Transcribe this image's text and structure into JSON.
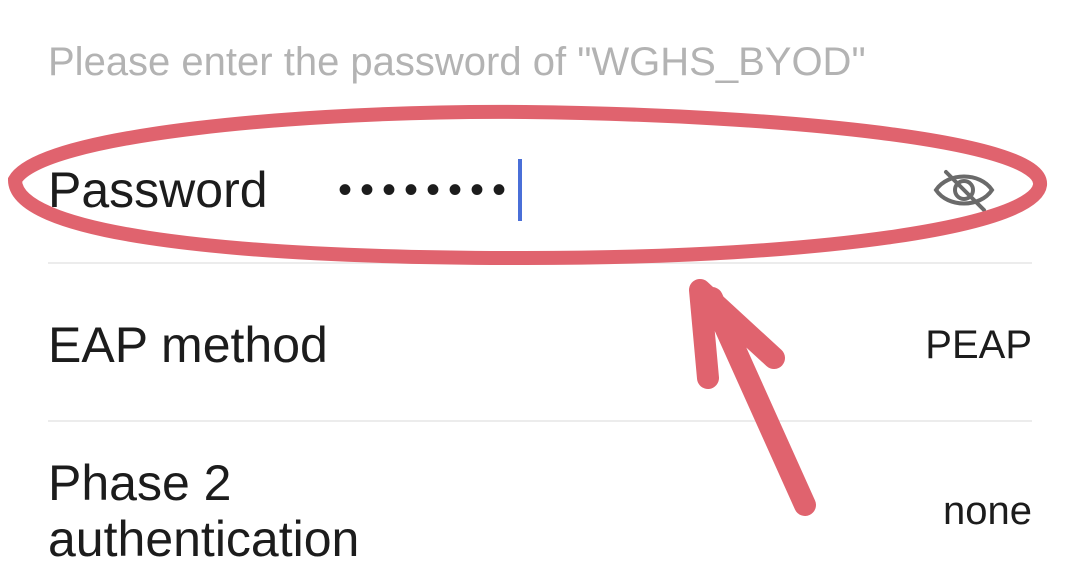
{
  "prompt": "Please enter the password of \"WGHS_BYOD\"",
  "password": {
    "label": "Password",
    "masked_value": "••••••••",
    "visibility_icon": "eye-off-icon"
  },
  "eap": {
    "label": "EAP method",
    "value": "PEAP"
  },
  "phase2": {
    "label": "Phase 2\nauthentication",
    "value": "none"
  },
  "colors": {
    "annotation": "#e0636e",
    "caret": "#4a6fd8",
    "divider": "#ececec"
  }
}
